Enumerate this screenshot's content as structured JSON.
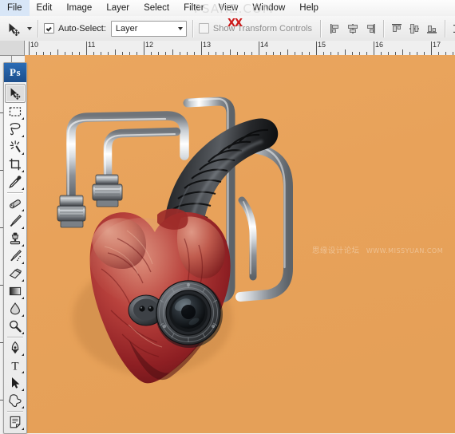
{
  "app": {
    "name": "Adobe Photoshop",
    "logo_text": "Ps"
  },
  "menubar": {
    "items": [
      {
        "label": "File",
        "name": "menu-file"
      },
      {
        "label": "Edit",
        "name": "menu-edit"
      },
      {
        "label": "Image",
        "name": "menu-image"
      },
      {
        "label": "Layer",
        "name": "menu-layer"
      },
      {
        "label": "Select",
        "name": "menu-select"
      },
      {
        "label": "Filter",
        "name": "menu-filter"
      },
      {
        "label": "View",
        "name": "menu-view"
      },
      {
        "label": "Window",
        "name": "menu-window"
      },
      {
        "label": "Help",
        "name": "menu-help"
      }
    ]
  },
  "options_bar": {
    "tool_preset_icon": "move-tool-icon",
    "auto_select": {
      "label": "Auto-Select:",
      "checked": true,
      "value": "Layer"
    },
    "show_transform_controls": {
      "label": "Show Transform Controls",
      "checked": false
    },
    "align_buttons": [
      {
        "name": "align-left-edges-button",
        "label": "Align left edges"
      },
      {
        "name": "align-horizontal-centers-button",
        "label": "Align horizontal centers"
      },
      {
        "name": "align-right-edges-button",
        "label": "Align right edges"
      },
      {
        "name": "align-top-edges-button",
        "label": "Align top edges"
      },
      {
        "name": "align-vertical-centers-button",
        "label": "Align vertical centers"
      },
      {
        "name": "align-bottom-edges-button",
        "label": "Align bottom edges"
      },
      {
        "name": "distribute-top-edges-button",
        "label": "Distribute top edges"
      },
      {
        "name": "distribute-vertical-centers-button",
        "label": "Distribute vertical centers"
      },
      {
        "name": "distribute-bottom-edges-button",
        "label": "Distribute bottom edges"
      }
    ]
  },
  "ruler": {
    "unit": "inches",
    "horizontal_labels": [
      "10",
      "11",
      "12",
      "13",
      "14",
      "15",
      "16",
      "17"
    ]
  },
  "toolbox": {
    "tools": [
      {
        "name": "move-tool",
        "label": "Move Tool",
        "selected": true,
        "has_submenu": false
      },
      {
        "name": "rectangular-marquee-tool",
        "label": "Rectangular Marquee Tool",
        "selected": false,
        "has_submenu": true
      },
      {
        "name": "lasso-tool",
        "label": "Lasso Tool",
        "selected": false,
        "has_submenu": true
      },
      {
        "name": "magic-wand-tool",
        "label": "Magic Wand Tool",
        "selected": false,
        "has_submenu": true
      },
      {
        "name": "crop-tool",
        "label": "Crop Tool",
        "selected": false,
        "has_submenu": true
      },
      {
        "name": "eyedropper-tool",
        "label": "Eyedropper Tool",
        "selected": false,
        "has_submenu": true
      },
      {
        "name": "healing-brush-tool",
        "label": "Spot Healing Brush Tool",
        "selected": false,
        "has_submenu": true
      },
      {
        "name": "brush-tool",
        "label": "Brush Tool",
        "selected": false,
        "has_submenu": true
      },
      {
        "name": "clone-stamp-tool",
        "label": "Clone Stamp Tool",
        "selected": false,
        "has_submenu": true
      },
      {
        "name": "history-brush-tool",
        "label": "History Brush Tool",
        "selected": false,
        "has_submenu": true
      },
      {
        "name": "eraser-tool",
        "label": "Eraser Tool",
        "selected": false,
        "has_submenu": true
      },
      {
        "name": "gradient-tool",
        "label": "Gradient Tool",
        "selected": false,
        "has_submenu": true
      },
      {
        "name": "blur-tool",
        "label": "Blur Tool",
        "selected": false,
        "has_submenu": true
      },
      {
        "name": "dodge-tool",
        "label": "Dodge Tool",
        "selected": false,
        "has_submenu": true
      },
      {
        "name": "pen-tool",
        "label": "Pen Tool",
        "selected": false,
        "has_submenu": true
      },
      {
        "name": "horizontal-type-tool",
        "label": "Horizontal Type Tool",
        "selected": false,
        "has_submenu": true
      },
      {
        "name": "path-selection-tool",
        "label": "Path Selection Tool",
        "selected": false,
        "has_submenu": true
      },
      {
        "name": "custom-shape-tool",
        "label": "Custom Shape Tool",
        "selected": false,
        "has_submenu": true
      },
      {
        "name": "notes-tool",
        "label": "Notes Tool",
        "selected": false,
        "has_submenu": true
      }
    ]
  },
  "canvas": {
    "background_color": "#e9a35c",
    "artwork_title": "Mechanical heart with camera lens and hoses",
    "watermark": {
      "cn": "思缘设计论坛",
      "en": "WWW.MISSYUAN.COM"
    },
    "overlay_watermark": {
      "text": "PSAHZ.COM",
      "mark": "XX"
    }
  },
  "colors": {
    "canvas_bg": "#e9a35c",
    "chrome_light": "#f2f2f2",
    "chrome_dark": "#9e9e9e",
    "accent_blue": "#2b6cb5",
    "watermark_red": "#cc1a1a"
  }
}
